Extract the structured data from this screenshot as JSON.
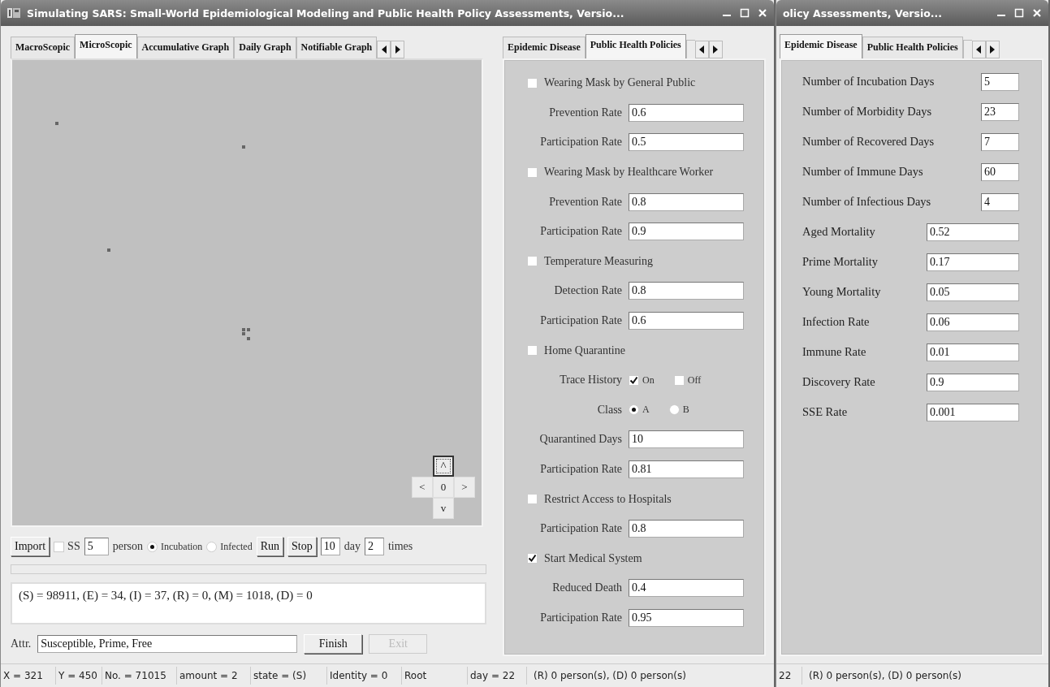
{
  "main_window": {
    "title": "Simulating SARS: Small-World Epidemiological Modeling and Public Health Policy Assessments, Versio...",
    "view_tabs": [
      {
        "label": "MacroScopic",
        "selected": false
      },
      {
        "label": "MicroScopic",
        "selected": true
      },
      {
        "label": "Accumulative Graph",
        "selected": false
      },
      {
        "label": "Daily Graph",
        "selected": false
      },
      {
        "label": "Notifiable Graph",
        "selected": false
      }
    ],
    "nav_pad": [
      {
        "label": "^",
        "focused": true
      },
      {
        "label": "<",
        "focused": false
      },
      {
        "label": "0",
        "focused": false
      },
      {
        "label": ">",
        "focused": false
      },
      {
        "label": "v",
        "focused": false
      }
    ],
    "controls": {
      "import_button": "Import",
      "ss": {
        "label": "SS",
        "checked": false
      },
      "persons": "5",
      "person_label": "person",
      "modes": [
        {
          "label": "Incubation",
          "selected": true
        },
        {
          "label": "Infected",
          "selected": false
        }
      ],
      "run_button": "Run",
      "stop_button": "Stop",
      "days": "10",
      "day_label": "day",
      "times": "2",
      "times_label": "times"
    },
    "progress": {
      "level": 0
    },
    "output_text": "(S) = 98911, (E) = 34, (I) = 37, (R) = 0, (M) = 1018, (D) = 0",
    "attr": {
      "label": "Attr.",
      "value": "Susceptible, Prime, Free",
      "buttons": [
        {
          "label": "Finish",
          "disabled": false
        },
        {
          "label": "Exit",
          "disabled": true
        }
      ]
    },
    "policy_tabs": [
      {
        "label": "Epidemic Disease",
        "selected": false
      },
      {
        "label": "Public Health Policies",
        "selected": true
      }
    ],
    "policies": [
      {
        "kind": "check",
        "label": "Wearing Mask by General Public",
        "checked": false
      },
      {
        "kind": "field",
        "label": "Prevention Rate",
        "value": "0.6"
      },
      {
        "kind": "field",
        "label": "Participation Rate",
        "value": "0.5"
      },
      {
        "kind": "check",
        "label": "Wearing Mask by Healthcare Worker",
        "checked": false
      },
      {
        "kind": "field",
        "label": "Prevention Rate",
        "value": "0.8"
      },
      {
        "kind": "field",
        "label": "Participation Rate",
        "value": "0.9"
      },
      {
        "kind": "check",
        "label": "Temperature Measuring",
        "checked": false
      },
      {
        "kind": "field",
        "label": "Detection Rate",
        "value": "0.8"
      },
      {
        "kind": "field",
        "label": "Participation Rate",
        "value": "0.6"
      },
      {
        "kind": "check",
        "label": "Home Quarantine",
        "checked": false
      },
      {
        "kind": "checks",
        "label": "Trace History",
        "options": [
          {
            "label": "On",
            "checked": true
          },
          {
            "label": "Off",
            "checked": false
          }
        ]
      },
      {
        "kind": "radios",
        "label": "Class",
        "options": [
          {
            "label": "A",
            "selected": true
          },
          {
            "label": "B",
            "selected": false
          }
        ]
      },
      {
        "kind": "field",
        "label": "Quarantined Days",
        "value": "10"
      },
      {
        "kind": "field",
        "label": "Participation Rate",
        "value": "0.81"
      },
      {
        "kind": "check",
        "label": "Restrict Access to Hospitals",
        "checked": false
      },
      {
        "kind": "field",
        "label": "Participation Rate",
        "value": "0.8"
      },
      {
        "kind": "check",
        "label": "Start Medical System",
        "checked": true
      },
      {
        "kind": "field",
        "label": "Reduced Death",
        "value": "0.4"
      },
      {
        "kind": "field",
        "label": "Participation Rate",
        "value": "0.95"
      }
    ],
    "status_bar": [
      "X = 321",
      "Y = 450",
      "No. = 71015",
      "amount = 2",
      "state = (S)",
      "Identity = 0",
      "Root",
      "day = 22",
      "(R) 0 person(s), (D) 0 person(s)"
    ]
  },
  "second_window": {
    "title": "olicy Assessments, Versio...",
    "tabs": [
      {
        "label": "Epidemic Disease",
        "selected": true
      },
      {
        "label": "Public Health Policies",
        "selected": false
      }
    ],
    "parameters": [
      {
        "kind": "days",
        "label": "Number of Incubation Days",
        "value": "5"
      },
      {
        "kind": "days",
        "label": "Number of Morbidity Days",
        "value": "23"
      },
      {
        "kind": "days",
        "label": "Number of Recovered Days",
        "value": "7"
      },
      {
        "kind": "days",
        "label": "Number of Immune Days",
        "value": "60"
      },
      {
        "kind": "days",
        "label": "Number of Infectious Days",
        "value": "4"
      },
      {
        "kind": "rate",
        "label": "Aged Mortality",
        "value": "0.52"
      },
      {
        "kind": "rate",
        "label": "Prime Mortality",
        "value": "0.17"
      },
      {
        "kind": "rate",
        "label": "Young Mortality",
        "value": "0.05"
      },
      {
        "kind": "rate",
        "label": "Infection Rate",
        "value": "0.06"
      },
      {
        "kind": "rate",
        "label": "Immune Rate",
        "value": "0.01"
      },
      {
        "kind": "rate",
        "label": "Discovery Rate",
        "value": "0.9"
      },
      {
        "kind": "rate",
        "label": "SSE Rate",
        "value": "0.001"
      }
    ],
    "status_bar": [
      "22",
      "(R) 0 person(s), (D) 0 person(s)"
    ]
  }
}
